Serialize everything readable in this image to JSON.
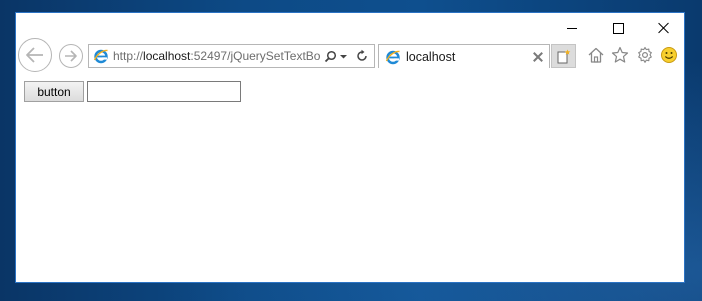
{
  "browser": {
    "address_prefix": "http://",
    "address_host": "localhost",
    "address_rest": ":52497/jQuerySetTextBo",
    "tab_title": "localhost"
  },
  "page": {
    "button_label": "button",
    "textbox_value": ""
  },
  "icons": {
    "back": "back-arrow-icon",
    "forward": "forward-arrow-icon",
    "search": "search-icon",
    "dropdown": "chevron-down-icon",
    "refresh": "refresh-icon",
    "home": "home-icon",
    "favorites": "star-icon",
    "settings": "gear-icon",
    "feedback": "smiley-icon",
    "site": "ie-icon"
  },
  "colors": {
    "window_border": "#2b73c4",
    "desktop": "#0d4a86"
  }
}
